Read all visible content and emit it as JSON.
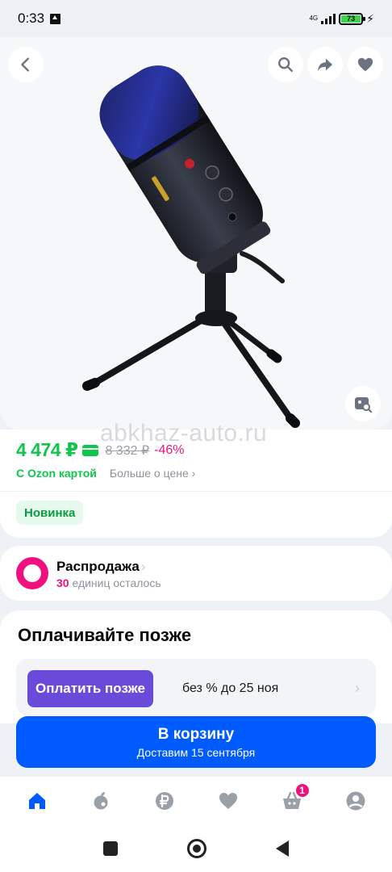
{
  "status_bar": {
    "time": "0:33",
    "network": "4G",
    "battery": "73"
  },
  "product": {
    "image_alt": "USB microphone on tripod stand",
    "price": "4 474 ₽",
    "old_price": "8 332 ₽",
    "discount": "-46%",
    "card_label": "С Ozon картой",
    "more_price_label": "Больше о цене ›",
    "badge": "Новинка",
    "watermark": "abkhaz-auto.ru"
  },
  "sale": {
    "title": "Распродажа",
    "count": "30",
    "remaining_label": "единиц осталось"
  },
  "pay_later": {
    "title": "Оплачивайте позже",
    "button": "Оплатить позже",
    "terms": "без % до 25 ноя"
  },
  "cart_button": {
    "label": "В корзину",
    "delivery": "Доставим 15 сентября"
  },
  "bottom_nav": {
    "cart_count": "1",
    "items": [
      "home-icon",
      "fruit-icon",
      "ruble-icon",
      "heart-icon",
      "basket-icon",
      "profile-icon"
    ]
  },
  "colors": {
    "brand_blue": "#005bff",
    "price_green": "#10c44c",
    "accent_pink": "#f1117e",
    "pay_later_purple": "#6a4bd9"
  }
}
